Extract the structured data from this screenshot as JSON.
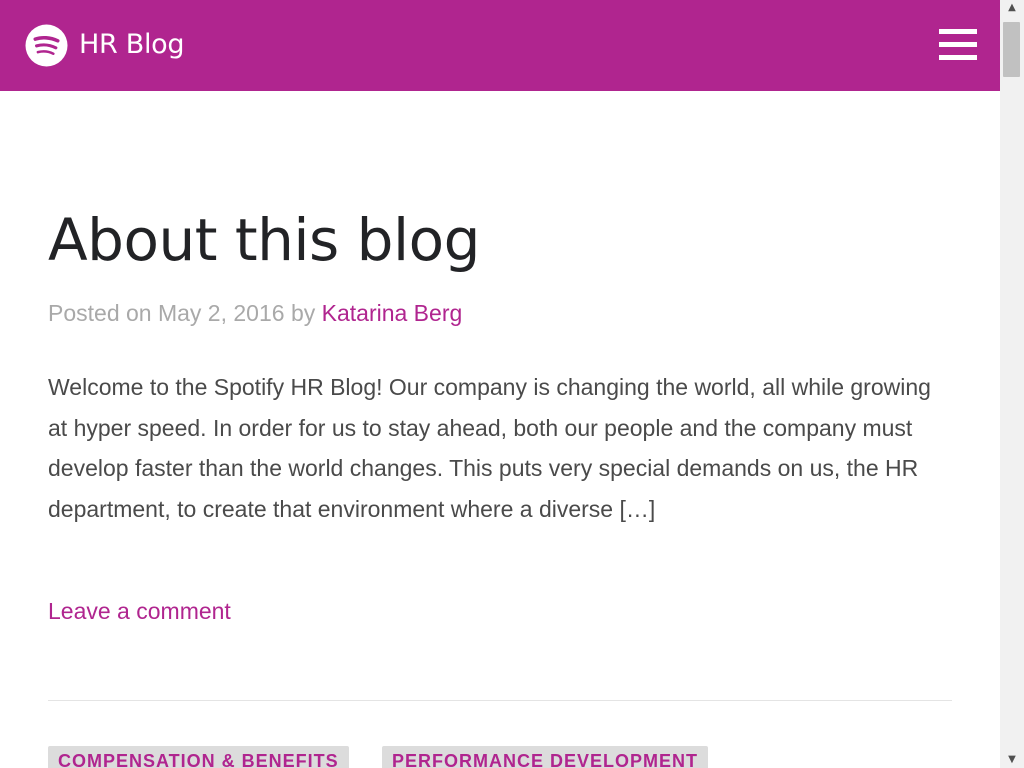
{
  "header": {
    "site_title": "HR Blog",
    "logo_icon": "spotify-logo-icon",
    "menu_icon": "hamburger-menu-icon",
    "background_color": "#b0258f"
  },
  "post": {
    "title": "About this blog",
    "meta_prefix": "Posted on May 2, 2016 by ",
    "author": "Katarina Berg",
    "excerpt": "Welcome to the Spotify HR Blog! Our company is changing the world, all while growing at hyper speed. In order for us to stay ahead, both our people and the company must develop faster than the world changes. This puts very special demands on us, the HR department, to create that environment where a diverse […]",
    "comment_link": "Leave a comment"
  },
  "tags": [
    "COMPENSATION & BENEFITS",
    "PERFORMANCE DEVELOPMENT"
  ],
  "colors": {
    "accent": "#b0258f",
    "title_text": "#222326",
    "body_text": "#4a4a4a",
    "meta_text": "#a9a9a9",
    "tag_background": "#dcdcdc"
  },
  "scrollbar": {
    "up_arrow": "▲",
    "down_arrow": "▼"
  }
}
